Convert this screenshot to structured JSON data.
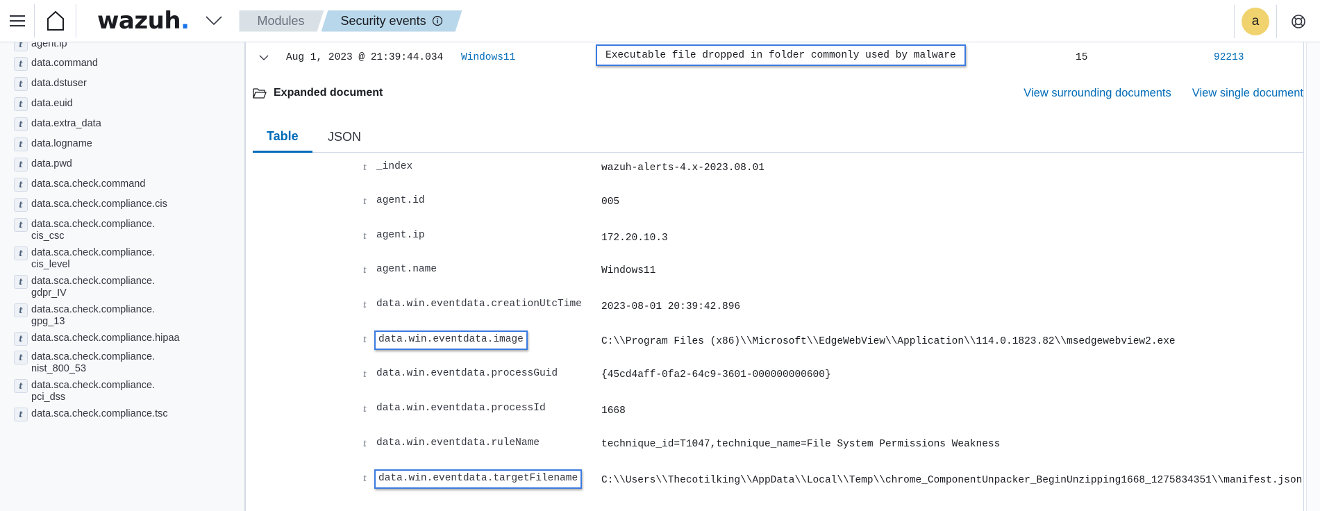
{
  "header": {
    "logo_text": "wazuh",
    "logo_dot": ".",
    "breadcrumbs": [
      "Modules",
      "Security events"
    ],
    "avatar_letter": "a",
    "brand_color": "#1a73e8"
  },
  "sidebar": {
    "fields": [
      {
        "type": "t",
        "name": "agent.ip"
      },
      {
        "type": "t",
        "name": "data.command"
      },
      {
        "type": "t",
        "name": "data.dstuser"
      },
      {
        "type": "t",
        "name": "data.euid"
      },
      {
        "type": "t",
        "name": "data.extra_data"
      },
      {
        "type": "t",
        "name": "data.logname"
      },
      {
        "type": "t",
        "name": "data.pwd"
      },
      {
        "type": "t",
        "name": "data.sca.check.command"
      },
      {
        "type": "t",
        "name": "data.sca.check.compliance.cis"
      },
      {
        "type": "t",
        "name": "data.sca.check.compliance.\ncis_csc"
      },
      {
        "type": "t",
        "name": "data.sca.check.compliance.\ncis_level"
      },
      {
        "type": "t",
        "name": "data.sca.check.compliance.\ngdpr_IV"
      },
      {
        "type": "t",
        "name": "data.sca.check.compliance.\ngpg_13"
      },
      {
        "type": "t",
        "name": "data.sca.check.compliance.hipaa"
      },
      {
        "type": "t",
        "name": "data.sca.check.compliance.\nnist_800_53"
      },
      {
        "type": "t",
        "name": "data.sca.check.compliance.\npci_dss"
      },
      {
        "type": "t",
        "name": "data.sca.check.compliance.tsc"
      }
    ]
  },
  "event_row": {
    "timestamp": "Aug 1, 2023 @ 21:39:44.034",
    "agent_name": "Windows11",
    "description": "Executable file dropped in folder commonly used by malware",
    "level": "15",
    "rule_id": "92213"
  },
  "document": {
    "title": "Expanded document",
    "view_surrounding": "View surrounding documents",
    "view_single": "View single document",
    "tabs": [
      "Table",
      "JSON"
    ],
    "active_tab": "Table",
    "fields": [
      {
        "type": "t",
        "key": "_index",
        "value": "wazuh-alerts-4.x-2023.08.01",
        "link": false,
        "highlight": false
      },
      {
        "type": "t",
        "key": "agent.id",
        "value": "005",
        "link": true,
        "highlight": false
      },
      {
        "type": "t",
        "key": "agent.ip",
        "value": "172.20.10.3",
        "link": false,
        "highlight": false
      },
      {
        "type": "t",
        "key": "agent.name",
        "value": "Windows11",
        "link": true,
        "highlight": false
      },
      {
        "type": "t",
        "key": "data.win.eventdata.creationUtcTime",
        "value": "2023-08-01 20:39:42.896",
        "link": false,
        "highlight": false
      },
      {
        "type": "t",
        "key": "data.win.eventdata.image",
        "value": "C:\\\\Program Files (x86)\\\\Microsoft\\\\EdgeWebView\\\\Application\\\\114.0.1823.82\\\\msedgewebview2.exe",
        "link": false,
        "highlight": true
      },
      {
        "type": "t",
        "key": "data.win.eventdata.processGuid",
        "value": "{45cd4aff-0fa2-64c9-3601-000000000600}",
        "link": false,
        "highlight": false
      },
      {
        "type": "t",
        "key": "data.win.eventdata.processId",
        "value": "1668",
        "link": false,
        "highlight": false
      },
      {
        "type": "t",
        "key": "data.win.eventdata.ruleName",
        "value": "technique_id=T1047,technique_name=File System Permissions Weakness",
        "link": false,
        "highlight": false
      },
      {
        "type": "t",
        "key": "data.win.eventdata.targetFilename",
        "value": "C:\\\\Users\\\\Thecotilking\\\\AppData\\\\Local\\\\Temp\\\\chrome_ComponentUnpacker_BeginUnzipping1668_1275834351\\\\manifest.json",
        "link": false,
        "highlight": true
      }
    ]
  }
}
